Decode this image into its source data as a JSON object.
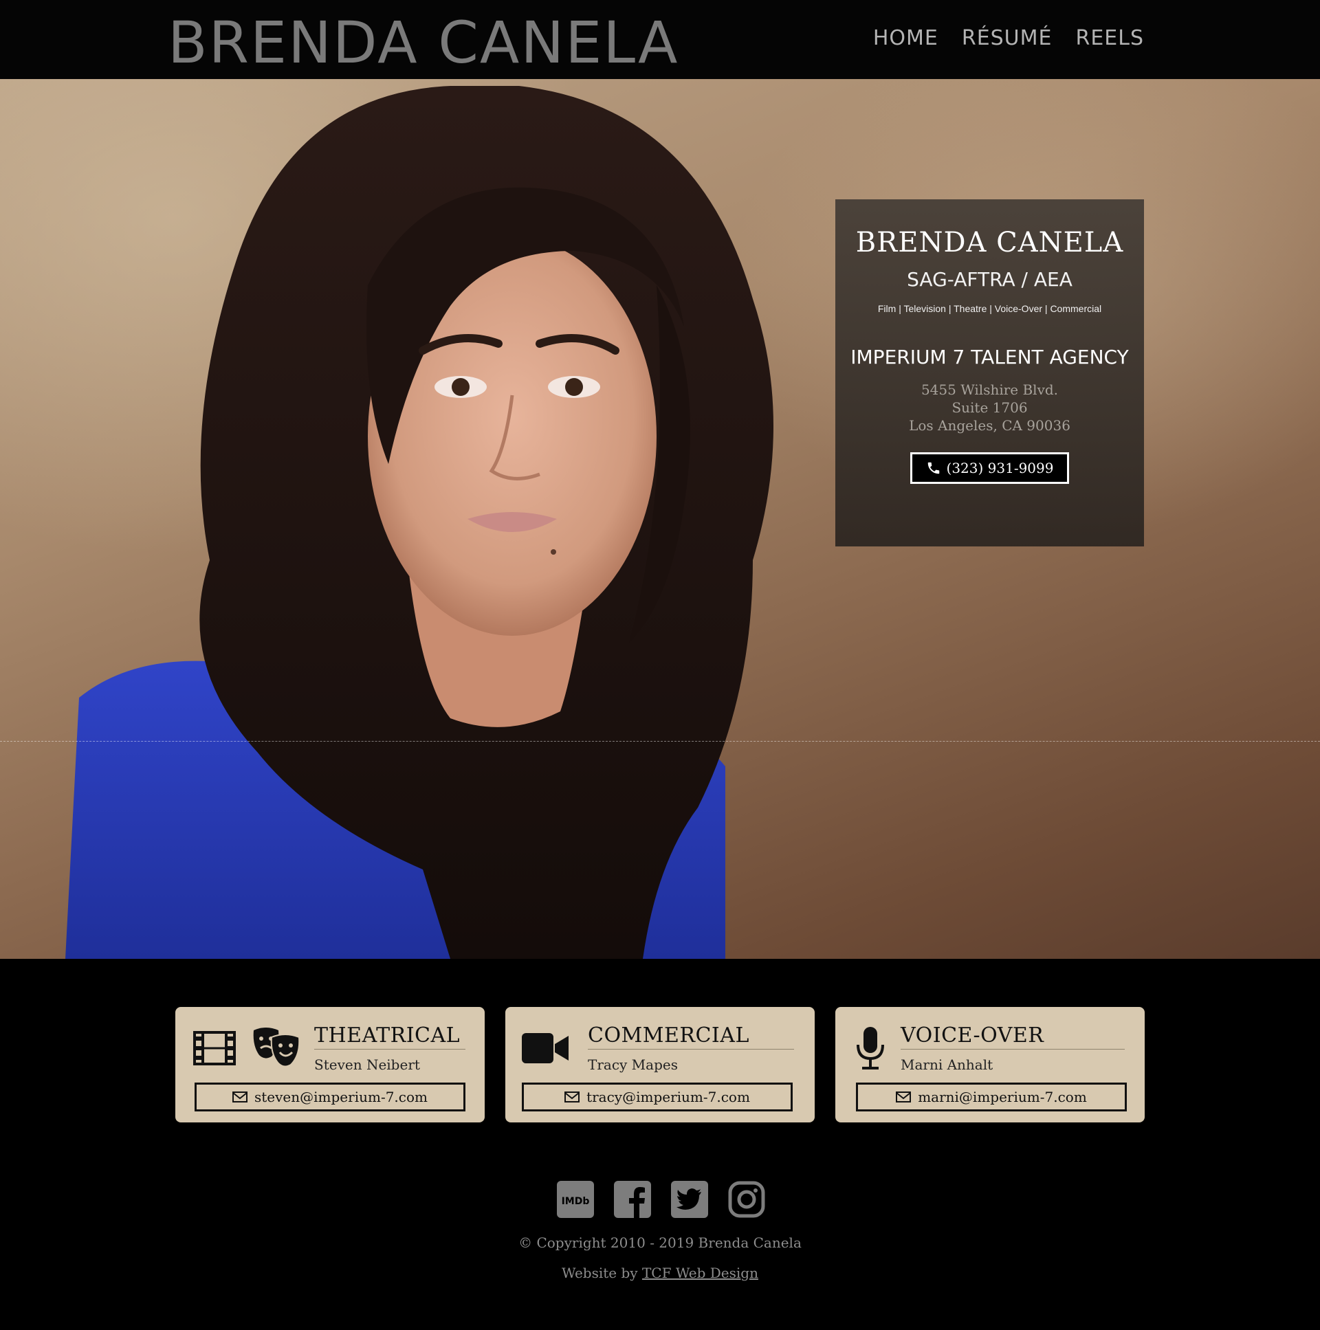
{
  "site": {
    "brand": "BRENDA CANELA",
    "nav": [
      "HOME",
      "RÉSUMÉ",
      "REELS"
    ]
  },
  "hero": {
    "photo": "headshot-portrait",
    "card": {
      "name": "BRENDA CANELA",
      "union": "SAG-AFTRA / AEA",
      "roles": "Film | Television | Theatre | Voice-Over | Commercial",
      "agency": "IMPERIUM 7 TALENT AGENCY",
      "address": [
        "5455 Wilshire Blvd.",
        "Suite 1706",
        "Los Angeles, CA 90036"
      ],
      "phone": "(323) 931-9099",
      "phone_icon": "phone-icon"
    }
  },
  "contacts": [
    {
      "title": "THEATRICAL",
      "person": "Steven Neibert",
      "email": "steven@imperium-7.com",
      "icons": [
        "film-icon",
        "theater-masks-icon"
      ]
    },
    {
      "title": "COMMERCIAL",
      "person": "Tracy Mapes",
      "email": "tracy@imperium-7.com",
      "icons": [
        "video-camera-icon"
      ]
    },
    {
      "title": "VOICE-OVER",
      "person": "Marni Anhalt",
      "email": "marni@imperium-7.com",
      "icons": [
        "microphone-icon"
      ]
    }
  ],
  "social": {
    "imdb_label": "IMDb",
    "items": [
      "imdb-icon",
      "facebook-icon",
      "twitter-icon",
      "instagram-icon"
    ]
  },
  "footer": {
    "copyright": "© Copyright 2010 - 2019 Brenda Canela",
    "credit_prefix": "Website by",
    "credit_link": "TCF Web Design"
  },
  "colors": {
    "header_bg": "#050505",
    "brand_text": "#7a7a7a",
    "nav_text": "#b4b4b4",
    "card_bg": "#d8c9b0",
    "info_card_bg": "#3f3732",
    "footer_text": "#8d8d8d",
    "shirt": "#2a3ec0"
  }
}
